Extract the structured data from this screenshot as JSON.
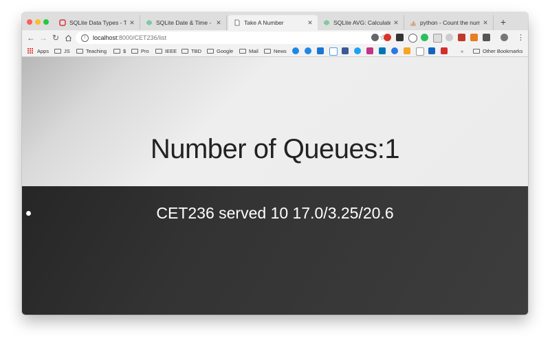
{
  "tabs": [
    {
      "title": "SQLite Data Types - Tutlane",
      "icon": "tutlane-icon",
      "active": false
    },
    {
      "title": "SQLite Date & Time - How T",
      "icon": "sqlite-icon",
      "active": false
    },
    {
      "title": "Take A Number",
      "icon": "page-icon",
      "active": true
    },
    {
      "title": "SQLite AVG: Calculate The A",
      "icon": "sqlite-icon",
      "active": false
    },
    {
      "title": "python - Count the number",
      "icon": "stackoverflow-icon",
      "active": false
    }
  ],
  "toolbar": {
    "url_host": "localhost",
    "url_path": ":8000/CET236/list",
    "new_tab": "+",
    "menu": "⋮"
  },
  "bookmarks": {
    "apps": "Apps",
    "folders": [
      "JS",
      "Teaching",
      "$",
      "Pro",
      "IEEE",
      "TBD",
      "Google",
      "Mail",
      "News"
    ],
    "overflow": "»",
    "other": "Other Bookmarks"
  },
  "page": {
    "title": "Number of Queues:1",
    "queues": [
      {
        "text": "CET236 served 10 17.0/3.25/20.6"
      }
    ]
  },
  "colors": {
    "header_bg": "#ececec",
    "list_bg": "#3a3a3a",
    "tab_active_bg": "#f2f2f2",
    "chrome_bg": "#dedede"
  }
}
